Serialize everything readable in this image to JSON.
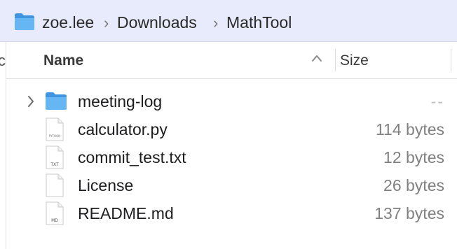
{
  "pathbar": {
    "crumbs": [
      "zoe.lee",
      "Downloads",
      "MathTool"
    ],
    "separator": "›"
  },
  "left_partial_char": "c",
  "header": {
    "name_label": "Name",
    "size_label": "Size"
  },
  "files": [
    {
      "name": "meeting-log",
      "size": "--",
      "kind": "folder",
      "icon_label": ""
    },
    {
      "name": "calculator.py",
      "size": "114 bytes",
      "kind": "file",
      "icon_label": "PYTHON"
    },
    {
      "name": "commit_test.txt",
      "size": "12 bytes",
      "kind": "file",
      "icon_label": "TXT"
    },
    {
      "name": "License",
      "size": "26 bytes",
      "kind": "file",
      "icon_label": ""
    },
    {
      "name": "README.md",
      "size": "137 bytes",
      "kind": "file",
      "icon_label": "MD"
    }
  ],
  "colors": {
    "pathbar_bg": "#e8ebfb",
    "folder_blue": "#5aaef0",
    "muted_text": "#808080"
  }
}
